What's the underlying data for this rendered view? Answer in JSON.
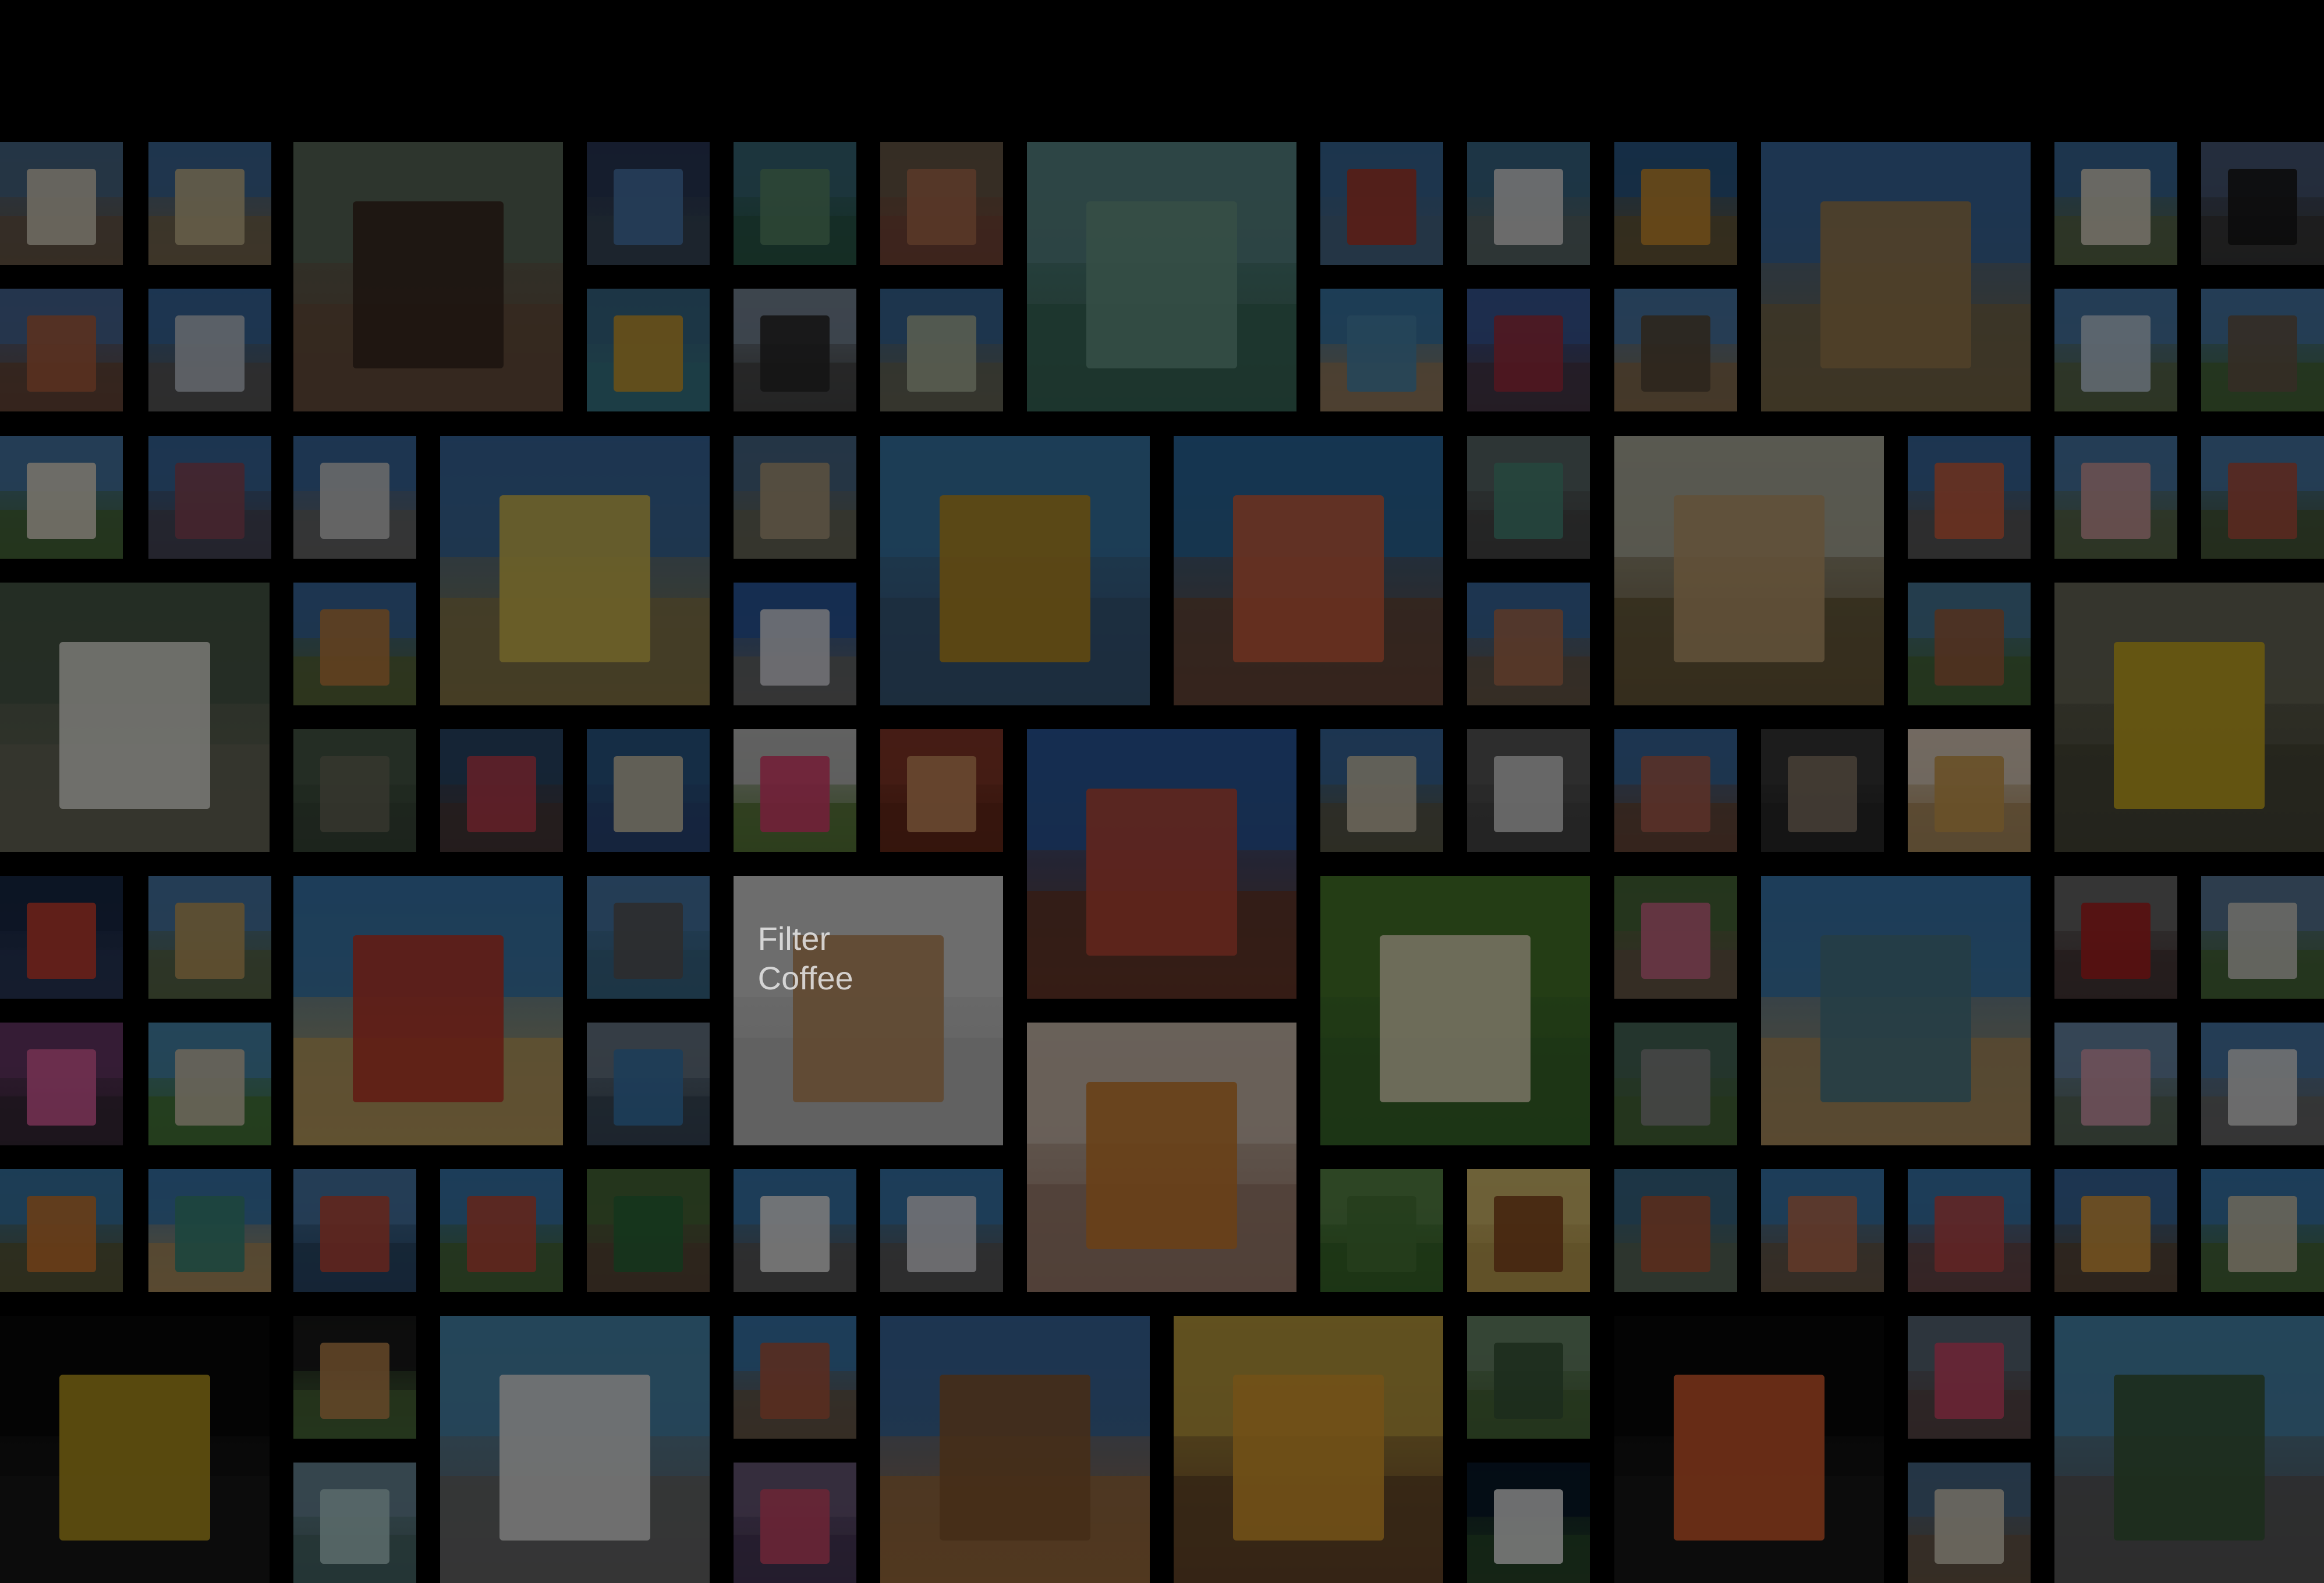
{
  "photo_wall": {
    "tiles": [
      {
        "name": "photo-ice-house",
        "sky": "#4a6a8a",
        "ground": "#6b5a4a",
        "subject": "#d8d0c0"
      },
      {
        "name": "photo-flyover",
        "sky": "#3d6a9a",
        "ground": "#7a6a50",
        "subject": "#c8b890"
      },
      {
        "name": "photo-steam-roller",
        "sky": "#5a6a5a",
        "ground": "#6a5040",
        "subject": "#3a2a20"
      },
      {
        "name": "photo-metro-train",
        "sky": "#2a3a5a",
        "ground": "#3a4a5a",
        "subject": "#4a7ab0"
      },
      {
        "name": "photo-lake-campus",
        "sky": "#3a6a7a",
        "ground": "#2a5a4a",
        "subject": "#5a8a6a"
      },
      {
        "name": "photo-street-market",
        "sky": "#6a5a4a",
        "ground": "#7a4a3a",
        "subject": "#b07050"
      },
      {
        "name": "photo-lake-view",
        "sky": "#5a8a8a",
        "ground": "#3a6a5a",
        "subject": "#6a9a8a"
      },
      {
        "name": "photo-pagoda",
        "sky": "#3a6a9a",
        "ground": "#4a6a8a",
        "subject": "#b03a2a"
      },
      {
        "name": "photo-white-arch-bridge",
        "sky": "#3a6a8a",
        "ground": "#5a6a6a",
        "subject": "#e0e0e0"
      },
      {
        "name": "photo-sculpture-rays",
        "sky": "#2a5a8a",
        "ground": "#6a5a3a",
        "subject": "#d09030"
      },
      {
        "name": "photo-shore-temple",
        "sky": "#3a6aa0",
        "ground": "#7a6a4a",
        "subject": "#a08050"
      },
      {
        "name": "photo-government-building",
        "sky": "#3a6a9a",
        "ground": "#5a6a4a",
        "subject": "#e0d8c8"
      },
      {
        "name": "photo-tower-sunset",
        "sky": "#4a5a7a",
        "ground": "#3a3a3a",
        "subject": "#1a1a1a"
      },
      {
        "name": "photo-red-building",
        "sky": "#4a6a9a",
        "ground": "#6a4a3a",
        "subject": "#b06040"
      },
      {
        "name": "photo-hospital-building",
        "sky": "#3a6aa0",
        "ground": "#5a5a5a",
        "subject": "#c0c8d0"
      },
      {
        "name": "photo-fishing-boats",
        "sky": "#3a6a8a",
        "ground": "#3a7a8a",
        "subject": "#d0a030"
      },
      {
        "name": "photo-labour-statue",
        "sky": "#7a8a9a",
        "ground": "#4a4a4a",
        "subject": "#2a2a2a"
      },
      {
        "name": "photo-arch-gateway",
        "sky": "#3a6a9a",
        "ground": "#6a6a5a",
        "subject": "#b0b8a0"
      },
      {
        "name": "photo-beach-wide",
        "sky": "#3a7aaa",
        "ground": "#9a8060",
        "subject": "#4a8ab0"
      },
      {
        "name": "photo-elephant-sign",
        "sky": "#3a5a9a",
        "ground": "#4a3a4a",
        "subject": "#a03040"
      },
      {
        "name": "photo-catamaran",
        "sky": "#4a7aaa",
        "ground": "#8a7050",
        "subject": "#5a4a3a"
      },
      {
        "name": "photo-old-mansion",
        "sky": "#4a7aaa",
        "ground": "#5a6a4a",
        "subject": "#c0d0e0"
      },
      {
        "name": "photo-stone-fort",
        "sky": "#4a7aaa",
        "ground": "#4a6a3a",
        "subject": "#6a5a4a"
      },
      {
        "name": "photo-white-palace",
        "sky": "#4a7aaa",
        "ground": "#4a6a3a",
        "subject": "#e8e0d0"
      },
      {
        "name": "photo-shopping-mall",
        "sky": "#3a6aa0",
        "ground": "#4a4a5a",
        "subject": "#8a4a5a"
      },
      {
        "name": "photo-stadium",
        "sky": "#3a6aa0",
        "ground": "#6a6a6a",
        "subject": "#d0d0d0"
      },
      {
        "name": "photo-yellow-church",
        "sky": "#3a6aa0",
        "ground": "#8a7a4a",
        "subject": "#d8c050"
      },
      {
        "name": "photo-heritage-house",
        "sky": "#4a6a8a",
        "ground": "#6a6a5a",
        "subject": "#b0a080"
      },
      {
        "name": "photo-chariot-memorial",
        "sky": "#3a7aaa",
        "ground": "#3a5a7a",
        "subject": "#c09020"
      },
      {
        "name": "photo-temple-gopuram",
        "sky": "#2a6aa0",
        "ground": "#6a4a3a",
        "subject": "#d06040"
      },
      {
        "name": "photo-suburban-train",
        "sky": "#5a6a6a",
        "ground": "#4a4a4a",
        "subject": "#4a8a7a"
      },
      {
        "name": "photo-mosque-domes",
        "sky": "#b0b0a0",
        "ground": "#6a5a3a",
        "subject": "#c0a070"
      },
      {
        "name": "photo-lighthouse",
        "sky": "#3a6aa0",
        "ground": "#5a5a5a",
        "subject": "#d06040"
      },
      {
        "name": "photo-pink-building",
        "sky": "#4a7aaa",
        "ground": "#5a6a4a",
        "subject": "#d0a0a0"
      },
      {
        "name": "photo-red-palace",
        "sky": "#4a7aaa",
        "ground": "#4a5a3a",
        "subject": "#b05040"
      },
      {
        "name": "photo-group-men",
        "sky": "#4a5a4a",
        "ground": "#6a6a5a",
        "subject": "#e8e8e0"
      },
      {
        "name": "photo-orange-building",
        "sky": "#3a6aa0",
        "ground": "#5a6a3a",
        "subject": "#c08040"
      },
      {
        "name": "photo-white-cathedral",
        "sky": "#2a5aa0",
        "ground": "#6a6a6a",
        "subject": "#e0e0e8"
      },
      {
        "name": "photo-railway-station",
        "sky": "#3a6aa0",
        "ground": "#6a5a4a",
        "subject": "#b07050"
      },
      {
        "name": "photo-brick-college",
        "sky": "#4a7a9a",
        "ground": "#4a6a3a",
        "subject": "#a06040"
      },
      {
        "name": "photo-auto-rickshaws",
        "sky": "#6a6a5a",
        "ground": "#4a4a3a",
        "subject": "#d0b020"
      },
      {
        "name": "photo-crocodile",
        "sky": "#4a5a4a",
        "ground": "#3a4a3a",
        "subject": "#6a6a5a"
      },
      {
        "name": "photo-shop-front",
        "sky": "#2a4a6a",
        "ground": "#4a3a3a",
        "subject": "#c04050"
      },
      {
        "name": "photo-pelican",
        "sky": "#2a5a8a",
        "ground": "#2a4a7a",
        "subject": "#d0c8b0"
      },
      {
        "name": "photo-amusement-park",
        "sky": "#c0c0c0",
        "ground": "#5a7a3a",
        "subject": "#e04070"
      },
      {
        "name": "photo-mehendi-hands",
        "sky": "#8a3a2a",
        "ground": "#6a2a1a",
        "subject": "#d09060"
      },
      {
        "name": "photo-clock-tower",
        "sky": "#2a5aa0",
        "ground": "#6a3a2a",
        "subject": "#c04a3a"
      },
      {
        "name": "photo-minarets",
        "sky": "#3a6aa0",
        "ground": "#5a5a4a",
        "subject": "#d0c8b0"
      },
      {
        "name": "photo-white-tiger",
        "sky": "#5a5a5a",
        "ground": "#4a4a4a",
        "subject": "#d8d8d8"
      },
      {
        "name": "photo-colonial-arches",
        "sky": "#3a6aa0",
        "ground": "#6a4a3a",
        "subject": "#b06050"
      },
      {
        "name": "photo-reptile",
        "sky": "#3a3a3a",
        "ground": "#2a2a2a",
        "subject": "#8a7a6a"
      },
      {
        "name": "photo-street-snack",
        "sky": "#e0d0c0",
        "ground": "#b09060",
        "subject": "#d0a050"
      },
      {
        "name": "photo-night-tower",
        "sky": "#1a2a4a",
        "ground": "#2a3a5a",
        "subject": "#d04030"
      },
      {
        "name": "photo-temple-pond",
        "sky": "#4a7aaa",
        "ground": "#5a6a4a",
        "subject": "#c0a060"
      },
      {
        "name": "photo-beach-mandapam",
        "sky": "#3a7ab0",
        "ground": "#c0a060",
        "subject": "#c03a2a"
      },
      {
        "name": "photo-bridge-river",
        "sky": "#4a7aaa",
        "ground": "#3a6a8a",
        "subject": "#5a5a5a"
      },
      {
        "name": "photo-filter-coffee",
        "sky": "#d8d8d8",
        "ground": "#c0c0c0",
        "subject": "#c09060",
        "text_lines": [
          "Filter",
          "Coffee"
        ]
      },
      {
        "name": "photo-south-indian-meal",
        "sky": "#4a7a2a",
        "ground": "#3a6a2a",
        "subject": "#e8e0c0"
      },
      {
        "name": "photo-village-dancers",
        "sky": "#4a6a3a",
        "ground": "#6a5a4a",
        "subject": "#d06a8a"
      },
      {
        "name": "photo-marina-beach",
        "sky": "#3a7ab0",
        "ground": "#b09060",
        "subject": "#4a7a8a"
      },
      {
        "name": "photo-red-train-carriage",
        "sky": "#6a6a6a",
        "ground": "#4a3a3a",
        "subject": "#b02020"
      },
      {
        "name": "photo-white-building-trees",
        "sky": "#5a7a9a",
        "ground": "#4a6a3a",
        "subject": "#d0d0c8"
      },
      {
        "name": "photo-temple-festival",
        "sky": "#6a3a6a",
        "ground": "#3a2a3a",
        "subject": "#e060a0"
      },
      {
        "name": "photo-bharatanatyam-dancer",
        "sky": "#d0c0b0",
        "ground": "#a08070",
        "subject": "#d08030"
      },
      {
        "name": "photo-pink-mansion",
        "sky": "#6a8aaa",
        "ground": "#5a6a5a",
        "subject": "#d8a0b0"
      },
      {
        "name": "photo-highway-junction",
        "sky": "#4a6a5a",
        "ground": "#4a6a3a",
        "subject": "#8a8a8a"
      },
      {
        "name": "photo-metro-station",
        "sky": "#6a7a8a",
        "ground": "#3a4a5a",
        "subject": "#3a7ab0"
      },
      {
        "name": "photo-memorial-column",
        "sky": "#4a8ab0",
        "ground": "#4a7a3a",
        "subject": "#d0c8b0"
      },
      {
        "name": "photo-temple-towers",
        "sky": "#4a7aaa",
        "ground": "#6a6a6a",
        "subject": "#e0e0e0"
      },
      {
        "name": "photo-gopuram-orange",
        "sky": "#3a7aaa",
        "ground": "#5a5a3a",
        "subject": "#d07a30"
      },
      {
        "name": "photo-coastline",
        "sky": "#3a7ab0",
        "ground": "#b09060",
        "subject": "#3a8a7a"
      },
      {
        "name": "photo-cargo-ship",
        "sky": "#4a7aaa",
        "ground": "#2a4a6a",
        "subject": "#c04a3a"
      },
      {
        "name": "photo-red-house",
        "sky": "#3a7ab0",
        "ground": "#4a6a3a",
        "subject": "#c04a3a"
      },
      {
        "name": "photo-banyan-grove",
        "sky": "#4a6a3a",
        "ground": "#5a4a3a",
        "subject": "#2a6a3a"
      },
      {
        "name": "photo-white-bridge",
        "sky": "#3a7ab0",
        "ground": "#5a5a5a",
        "subject": "#f0f0f0"
      },
      {
        "name": "photo-mansion-blue",
        "sky": "#3a7ab0",
        "ground": "#5a5a5a",
        "subject": "#e0e0e8"
      },
      {
        "name": "photo-forest-trees",
        "sky": "#5a8a4a",
        "ground": "#3a6a2a",
        "subject": "#4a7a3a"
      },
      {
        "name": "photo-veena",
        "sky": "#d8c070",
        "ground": "#c0a050",
        "subject": "#8a4a20"
      },
      {
        "name": "photo-pavilion",
        "sky": "#3a6a8a",
        "ground": "#5a6a5a",
        "subject": "#b05a3a"
      },
      {
        "name": "photo-gopuram-carved",
        "sky": "#3a7ab0",
        "ground": "#6a5a4a",
        "subject": "#c07050"
      },
      {
        "name": "photo-gopuram-painted",
        "sky": "#3a7ab0",
        "ground": "#6a4a4a",
        "subject": "#c04a4a"
      },
      {
        "name": "photo-sculpture-sunrays",
        "sky": "#3a6aa0",
        "ground": "#5a4a3a",
        "subject": "#e0a040"
      },
      {
        "name": "photo-war-memorial",
        "sky": "#3a7ab0",
        "ground": "#4a6a3a",
        "subject": "#d0c8b0"
      },
      {
        "name": "photo-spice-bowl",
        "sky": "#0a0a0a",
        "ground": "#1a1a1a",
        "subject": "#c0a020"
      },
      {
        "name": "photo-spotted-deer",
        "sky": "#1a1a1a",
        "ground": "#4a6a3a",
        "subject": "#c08a50"
      },
      {
        "name": "photo-cathedral-spire",
        "sky": "#4a8ab0",
        "ground": "#6a6a6a",
        "subject": "#e8e8e8"
      },
      {
        "name": "photo-terracotta-palace",
        "sky": "#3a7ab0",
        "ground": "#6a5a4a",
        "subject": "#b05a40"
      },
      {
        "name": "photo-butterball-rock",
        "sky": "#3a6aa0",
        "ground": "#a07040",
        "subject": "#8a5a30"
      },
      {
        "name": "photo-fruit-stall",
        "sky": "#c0a040",
        "ground": "#6a4a2a",
        "subject": "#e0a030"
      },
      {
        "name": "photo-park-entrance",
        "sky": "#6a8a6a",
        "ground": "#4a6a3a",
        "subject": "#3a5a3a"
      },
      {
        "name": "photo-classical-dancer",
        "sky": "#0a0a0a",
        "ground": "#1a1a1a",
        "subject": "#e06030"
      },
      {
        "name": "photo-family-group",
        "sky": "#5a6a7a",
        "ground": "#5a4a4a",
        "subject": "#d04a6a"
      },
      {
        "name": "photo-beach-road",
        "sky": "#4a8ab0",
        "ground": "#5a5a5a",
        "subject": "#3a5a3a"
      },
      {
        "name": "photo-mandala-art",
        "sky": "#6a8a9a",
        "ground": "#4a6a6a",
        "subject": "#b0d0d0"
      },
      {
        "name": "photo-gallery-interior",
        "sky": "#6a5a7a",
        "ground": "#4a3a5a",
        "subject": "#d04a6a"
      },
      {
        "name": "photo-stadium-night",
        "sky": "#0a1a2a",
        "ground": "#2a4a2a",
        "subject": "#f0f0f0"
      }
    ]
  }
}
